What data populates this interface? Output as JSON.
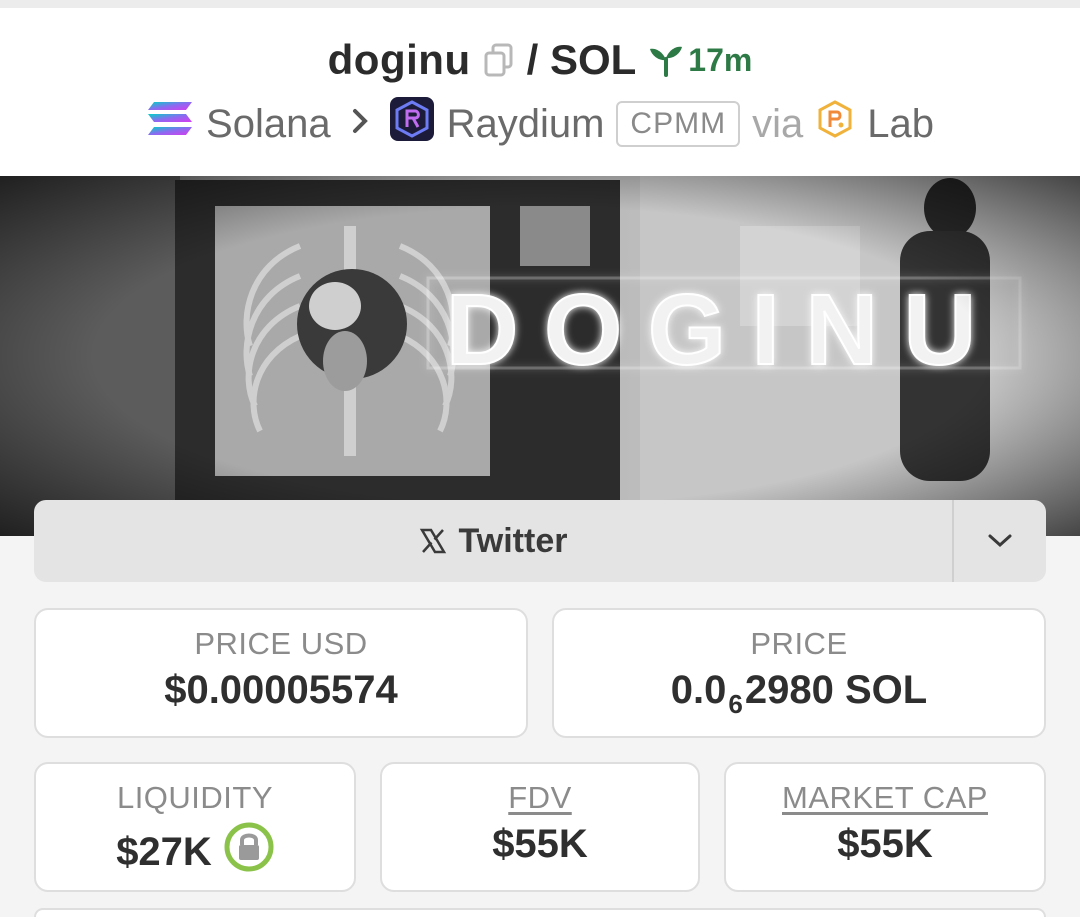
{
  "header": {
    "base_symbol": "doginu",
    "quote_symbol": "/ SOL",
    "age": "17m"
  },
  "breadcrumb": {
    "chain": "Solana",
    "dex": "Raydium",
    "pool_type": "CPMM",
    "via_label": "via",
    "launchpad": "Lab"
  },
  "banner": {
    "text": "DOGINU"
  },
  "twitter": {
    "label": "Twitter"
  },
  "stats": {
    "price_usd_label": "PRICE USD",
    "price_usd_value": "$0.00005574",
    "price_label": "PRICE",
    "price_prefix": "0.0",
    "price_zero_count": "6",
    "price_suffix": "2980 SOL",
    "liquidity_label": "LIQUIDITY",
    "liquidity_value": "$27K",
    "fdv_label": "FDV",
    "fdv_value": "$55K",
    "market_cap_label": "MARKET CAP",
    "market_cap_value": "$55K"
  },
  "colors": {
    "age_green": "#2d7a46",
    "lock_green": "#8bc34a"
  }
}
